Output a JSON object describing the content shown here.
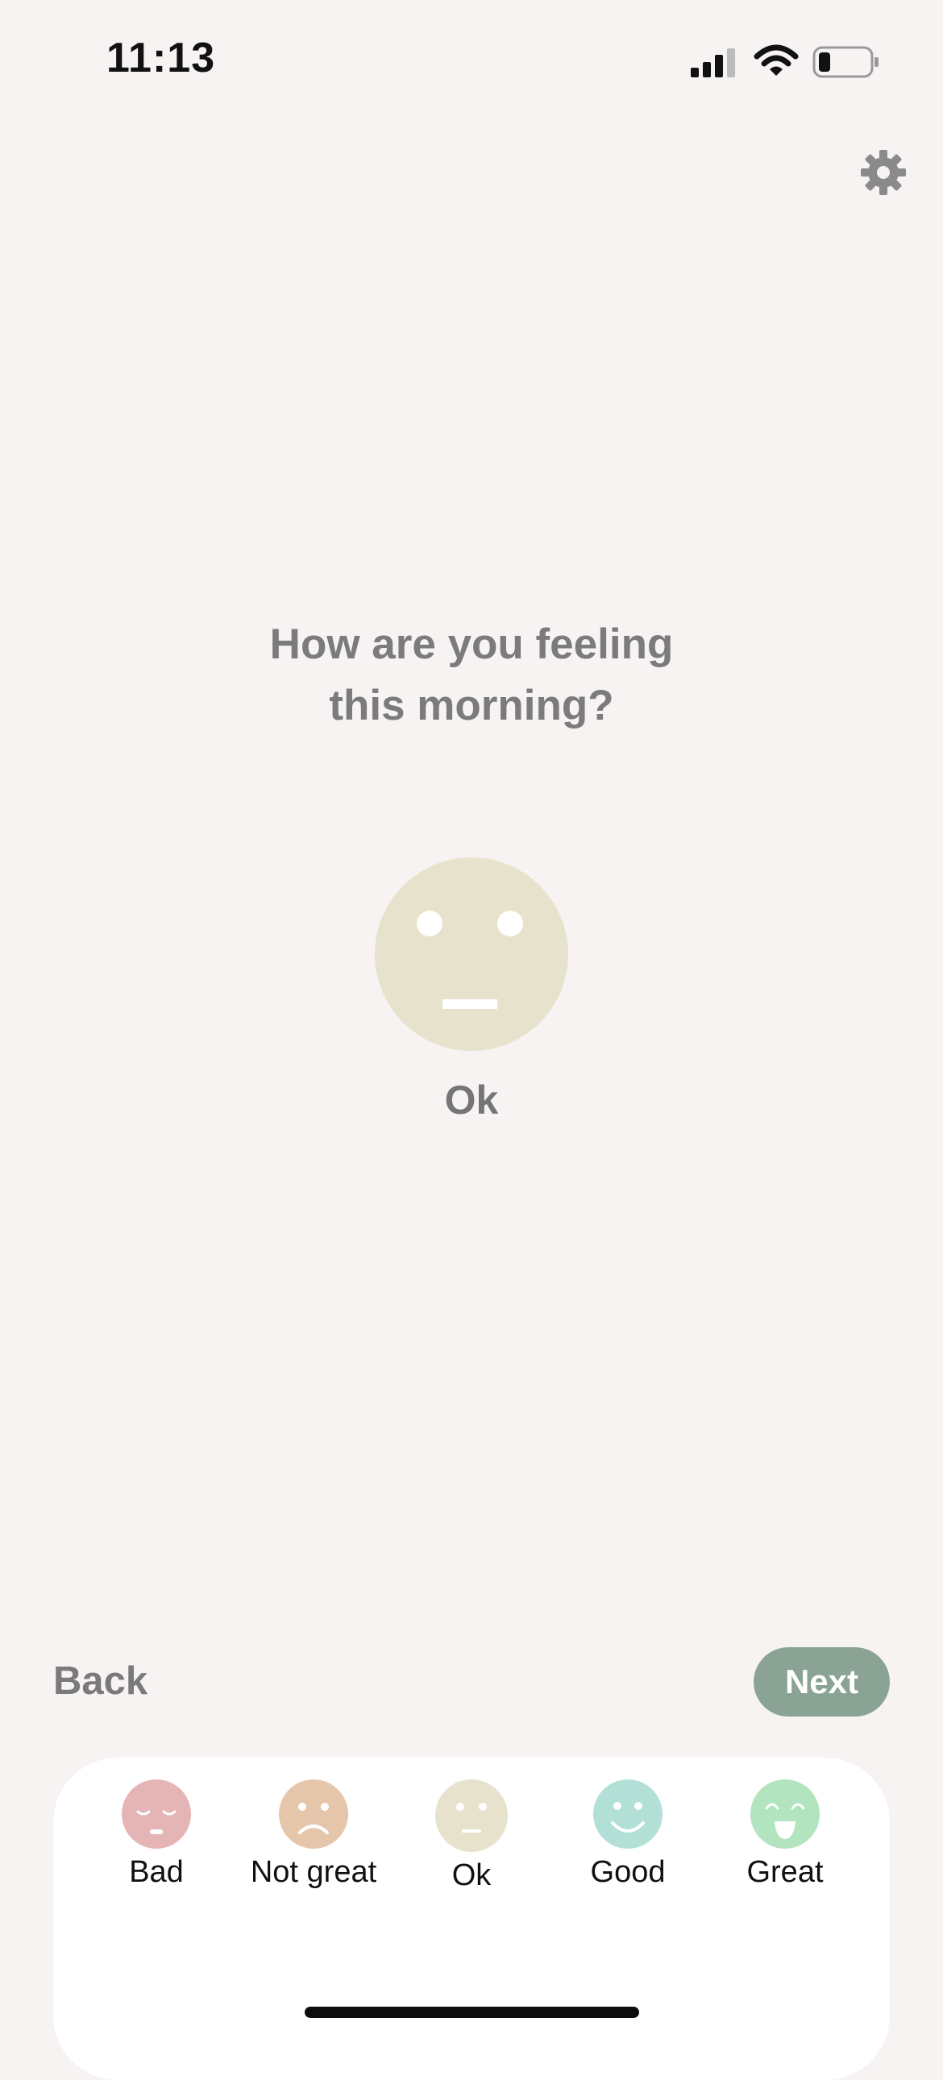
{
  "status_bar": {
    "time": "11:13"
  },
  "question": {
    "line1": "How are you feeling",
    "line2": "this morning?"
  },
  "selected_mood": {
    "label": "Ok",
    "color": "#e6e2cc",
    "icon": "neutral-face-icon"
  },
  "nav": {
    "back_label": "Back",
    "next_label": "Next"
  },
  "mood_options": [
    {
      "label": "Bad",
      "color": "#e4b5b4",
      "icon": "bad-face-icon"
    },
    {
      "label": "Not great",
      "color": "#e6c6ab",
      "icon": "not-great-face-icon"
    },
    {
      "label": "Ok",
      "color": "#e6e2cc",
      "icon": "ok-face-icon",
      "selected": true
    },
    {
      "label": "Good",
      "color": "#b2e0d6",
      "icon": "good-face-icon"
    },
    {
      "label": "Great",
      "color": "#b1e4bf",
      "icon": "great-face-icon"
    }
  ],
  "colors": {
    "background": "#f6f3f2",
    "next_button": "#8aa394",
    "panel": "#ffffff"
  }
}
